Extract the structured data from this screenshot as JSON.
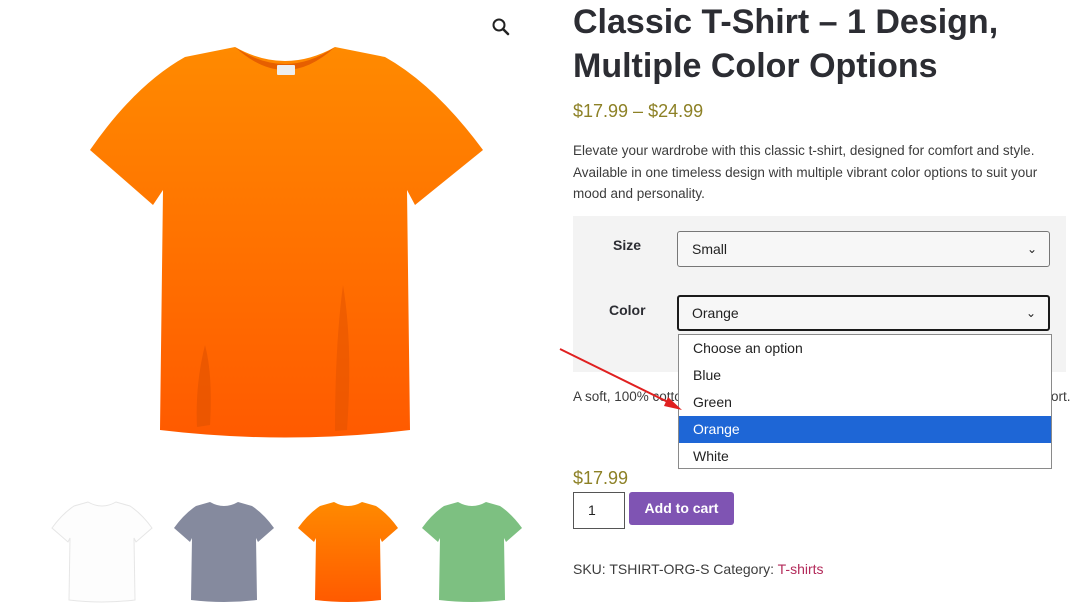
{
  "product": {
    "title": "Classic T-Shirt – 1 Design, Multiple Color Options",
    "price_range": "$17.99 – $24.99",
    "description": "Elevate your wardrobe with this classic t-shirt, designed for comfort and style. Available in one timeless design with multiple vibrant color options to suit your mood and personality.",
    "short_description": "A soft, 100% cotton t-shirt, pre-shrunk for a reliable fit, perfect for everyday comfort.",
    "variation_price": "$17.99",
    "quantity": "1",
    "add_to_cart_label": "Add to cart",
    "sku_label": "SKU:",
    "sku": "TSHIRT-ORG-S",
    "category_label": "Category:",
    "category": "T-shirts"
  },
  "gallery": {
    "main_color": "#ff6a00",
    "zoom_icon": "magnifier-icon",
    "thumbnails": [
      {
        "name": "white",
        "color": "#ffffff"
      },
      {
        "name": "gray",
        "color": "#858a9e"
      },
      {
        "name": "orange",
        "color": "#ff6a00"
      },
      {
        "name": "green",
        "color": "#7dc081"
      }
    ]
  },
  "variations": {
    "size_label": "Size",
    "size_value": "Small",
    "color_label": "Color",
    "color_value": "Orange",
    "color_options": [
      "Choose an option",
      "Blue",
      "Green",
      "Orange",
      "White"
    ],
    "selected_option": "Orange"
  },
  "colors": {
    "price": "#8d8126",
    "button": "#7f54b3",
    "link": "#b32a5a",
    "dropdown_highlight": "#1e66d6",
    "annotation_arrow": "#e02020"
  }
}
